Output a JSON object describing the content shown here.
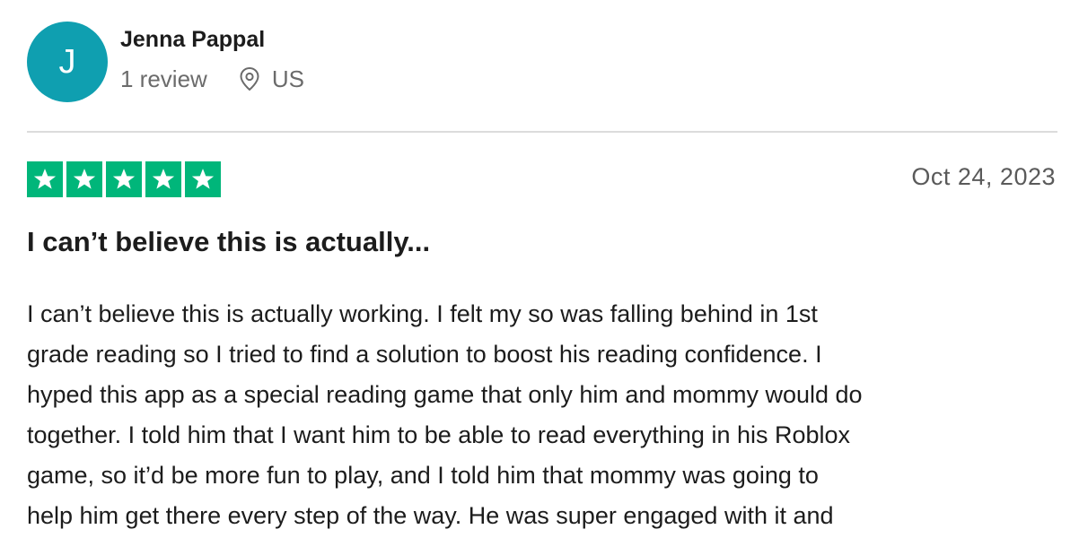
{
  "reviewer": {
    "initial": "J",
    "name": "Jenna Pappal",
    "review_count": "1 review",
    "location": "US",
    "avatar_color": "#0f9fb0"
  },
  "review": {
    "rating": 5,
    "rating_color": "#00b67a",
    "date": "Oct 24, 2023",
    "title": "I can’t believe this is actually...",
    "body": "I can’t believe this is actually working. I felt my so was falling behind in 1st\ngrade reading so I tried to find a solution to boost his reading confidence. I\nhyped this app as a special reading game that only him and mommy would do\ntogether. I told him that I want him to be able to read everything in his Roblox\ngame, so it’d be more fun to play, and I told him that mommy was going to\nhelp him get there every step of the way. He was super engaged with it and"
  },
  "icons": {
    "location": "map-pin-icon",
    "star": "star-icon"
  }
}
